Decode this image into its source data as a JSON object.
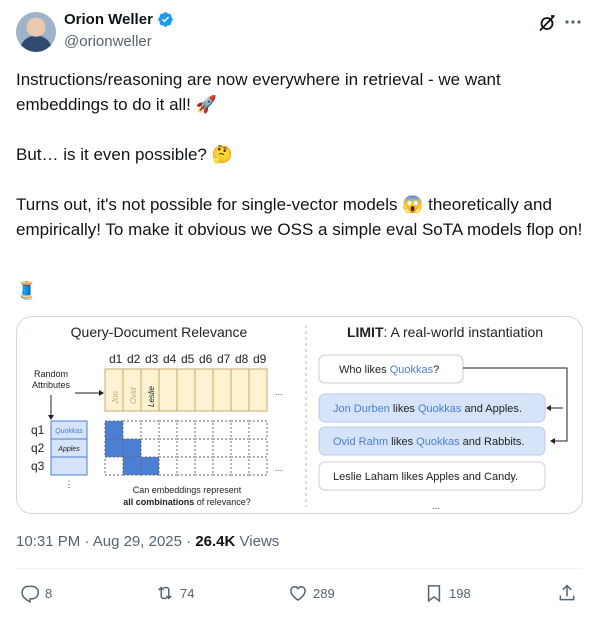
{
  "author": {
    "display_name": "Orion Weller",
    "handle": "@orionweller"
  },
  "tweet": {
    "paragraph1": "Instructions/reasoning are now everywhere in retrieval - we want embeddings to do it all! 🚀",
    "paragraph2": "But… is it even possible? 🤔",
    "paragraph3": "Turns out, it's not possible for single-vector models 😱 theoretically and empirically! To make it obvious we OSS a simple eval SoTA models flop on!",
    "thread_emoji": "🧵"
  },
  "figure": {
    "left_title": "Query-Document Relevance",
    "random_attributes": [
      "Random",
      "Attributes"
    ],
    "doc_labels": [
      "d1",
      "d2",
      "d3",
      "d4",
      "d5",
      "d6",
      "d7",
      "d8",
      "d9"
    ],
    "doc_attrs": [
      "Jon",
      "Ovid",
      "Leslie"
    ],
    "query_labels": [
      "q1",
      "q2",
      "q3"
    ],
    "query_attrs": [
      "Quokkas",
      "Apples"
    ],
    "caption_line1": "Can embeddings represent",
    "caption_line2_bold": "all combinations",
    "caption_line2_rest": "of relevance?",
    "right_title_bold": "LIMIT",
    "right_title_rest": ": A real-world instantiation",
    "query_bubble_pre": "Who likes ",
    "query_bubble_hl": "Quokkas",
    "query_bubble_post": "?",
    "doc1_name": "Jon Durben",
    "doc1_mid": " likes ",
    "doc1_hl": "Quokkas",
    "doc1_post": " and Apples.",
    "doc2_name": "Ovid Rahm",
    "doc2_mid": " likes ",
    "doc2_hl": "Quokkas",
    "doc2_post": " and Rabbits.",
    "doc3": "Leslie Laham likes Apples and Candy.",
    "ellipsis": "...",
    "matrix_fill": [
      [
        1,
        0,
        0,
        0,
        0,
        0,
        0,
        0,
        0
      ],
      [
        1,
        1,
        0,
        0,
        0,
        0,
        0,
        0,
        0
      ],
      [
        0,
        1,
        1,
        0,
        0,
        0,
        0,
        0,
        0
      ]
    ],
    "colors": {
      "accent_blue": "#4a7fd4",
      "doc_yellow": "#fdf3d2",
      "highlight_blue": "#d6e3f8"
    }
  },
  "meta": {
    "time": "10:31 PM",
    "separator": "·",
    "date": "Aug 29, 2025",
    "views_count": "26.4K",
    "views_label": "Views"
  },
  "actions": {
    "replies": "8",
    "reposts": "74",
    "likes": "289",
    "bookmarks": "198"
  },
  "accent": "#1d9bf0"
}
